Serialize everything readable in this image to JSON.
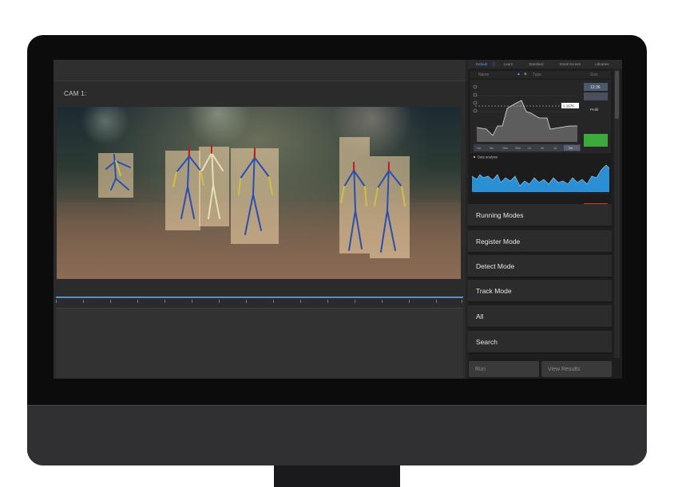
{
  "camera": {
    "label": "CAM 1:"
  },
  "right_panel": {
    "tabs": [
      "Default",
      "Learn",
      "Standard",
      "Small Screen",
      "Libraries"
    ],
    "columns": {
      "name": "Name",
      "type": "Type",
      "size": "Size"
    },
    "chart_badge_time": "12:36",
    "chart_badge_label": "Profit",
    "price_tag": "1.1576",
    "range_buttons": [
      "1m",
      "5m",
      "15m",
      "30m",
      "1h",
      "4h",
      "1d",
      "2m"
    ],
    "data_analysis_label": "Data analysis"
  },
  "menu": [
    "Running Modes",
    "Register Mode",
    "Detect Mode",
    "Track Mode",
    "All",
    "Search"
  ],
  "buttons": {
    "run": "Run",
    "view_results": "View Results"
  },
  "colors": {
    "accent_blue": "#5aa0e0",
    "chart_area": "#2b8fd6",
    "go_green": "#3caa3c",
    "stop_red": "#d23c2c"
  }
}
